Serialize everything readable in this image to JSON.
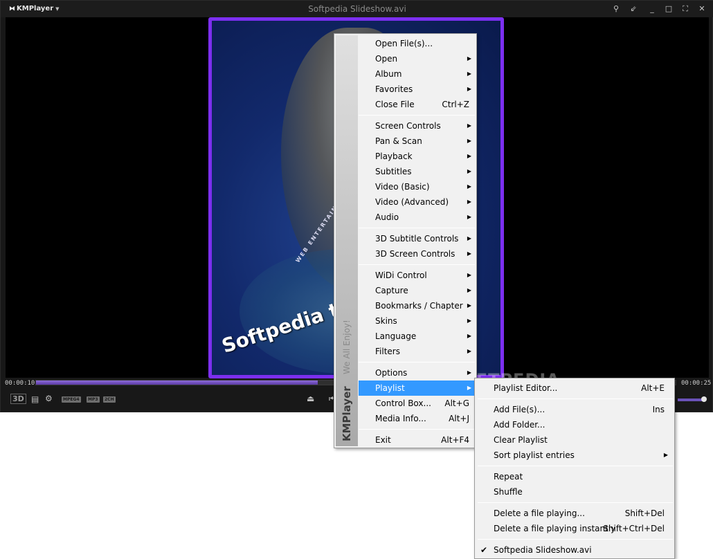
{
  "app": {
    "logo": "KMPlayer",
    "window_title": "Softpedia Slideshow.avi"
  },
  "video": {
    "frame_text": "Softpedia test",
    "frame_tagline": "WEB ENTERTAINMENT",
    "watermark": "SOFTPEDIA"
  },
  "controls": {
    "time_elapsed": "00:00:10",
    "time_total": "00:00:25",
    "progress": 0.44,
    "badge_3d": "3D",
    "badges": [
      "MPEG4",
      "MP3",
      "2CH"
    ],
    "volume": 1.0
  },
  "menu": {
    "brand": "KMPlayer",
    "slogan": "We All Enjoy!",
    "items": [
      {
        "label": "Open File(s)...",
        "shortcut": "",
        "submenu": false
      },
      {
        "label": "Open",
        "shortcut": "",
        "submenu": true
      },
      {
        "label": "Album",
        "shortcut": "",
        "submenu": true
      },
      {
        "label": "Favorites",
        "shortcut": "",
        "submenu": true
      },
      {
        "label": "Close File",
        "shortcut": "Ctrl+Z",
        "submenu": false
      },
      {
        "label": "Screen Controls",
        "shortcut": "",
        "submenu": true
      },
      {
        "label": "Pan & Scan",
        "shortcut": "",
        "submenu": true
      },
      {
        "label": "Playback",
        "shortcut": "",
        "submenu": true
      },
      {
        "label": "Subtitles",
        "shortcut": "",
        "submenu": true
      },
      {
        "label": "Video (Basic)",
        "shortcut": "",
        "submenu": true
      },
      {
        "label": "Video (Advanced)",
        "shortcut": "",
        "submenu": true
      },
      {
        "label": "Audio",
        "shortcut": "",
        "submenu": true
      },
      {
        "label": "3D Subtitle Controls",
        "shortcut": "",
        "submenu": true
      },
      {
        "label": "3D Screen Controls",
        "shortcut": "",
        "submenu": true
      },
      {
        "label": "WiDi Control",
        "shortcut": "",
        "submenu": true
      },
      {
        "label": "Capture",
        "shortcut": "",
        "submenu": true
      },
      {
        "label": "Bookmarks / Chapter",
        "shortcut": "",
        "submenu": true
      },
      {
        "label": "Skins",
        "shortcut": "",
        "submenu": true
      },
      {
        "label": "Language",
        "shortcut": "",
        "submenu": true
      },
      {
        "label": "Filters",
        "shortcut": "",
        "submenu": true
      },
      {
        "label": "Options",
        "shortcut": "",
        "submenu": true
      },
      {
        "label": "Playlist",
        "shortcut": "",
        "submenu": true,
        "highlighted": true
      },
      {
        "label": "Control Box...",
        "shortcut": "Alt+G",
        "submenu": false
      },
      {
        "label": "Media Info...",
        "shortcut": "Alt+J",
        "submenu": false
      },
      {
        "label": "Exit",
        "shortcut": "Alt+F4",
        "submenu": false
      }
    ]
  },
  "submenu": {
    "items": [
      {
        "label": "Playlist Editor...",
        "shortcut": "Alt+E",
        "submenu": false
      },
      {
        "label": "Add File(s)...",
        "shortcut": "Ins",
        "submenu": false
      },
      {
        "label": "Add Folder...",
        "shortcut": "",
        "submenu": false
      },
      {
        "label": "Clear Playlist",
        "shortcut": "",
        "submenu": false
      },
      {
        "label": "Sort playlist entries",
        "shortcut": "",
        "submenu": true
      },
      {
        "label": "Repeat",
        "shortcut": "",
        "submenu": false
      },
      {
        "label": "Shuffle",
        "shortcut": "",
        "submenu": false
      },
      {
        "label": "Delete a file playing...",
        "shortcut": "Shift+Del",
        "submenu": false
      },
      {
        "label": "Delete a file playing instantly",
        "shortcut": "Shift+Ctrl+Del",
        "submenu": false
      },
      {
        "label": "Softpedia Slideshow.avi",
        "shortcut": "",
        "submenu": false,
        "checked": true
      }
    ]
  },
  "colors": {
    "frame_border": "#7c2ff0",
    "menu_highlight": "#3399ff",
    "seek_fill": "#6f4fc0"
  }
}
